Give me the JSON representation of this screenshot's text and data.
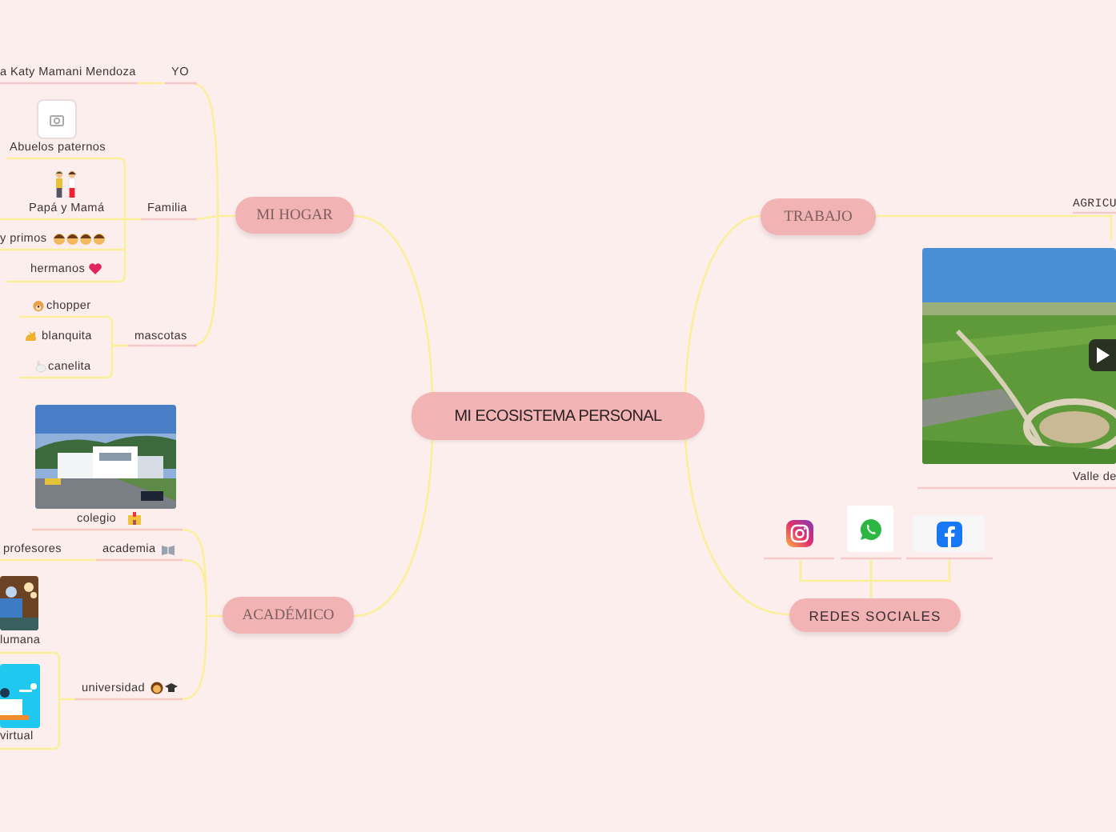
{
  "central": {
    "label": "MI ECOSISTEMA PERSONAL"
  },
  "hogar": {
    "label": "MI HOGAR",
    "yo": {
      "label": "YO",
      "name": "a Katy Mamani Mendoza"
    },
    "familia": {
      "label": "Familia",
      "members": [
        "Abuelos paternos",
        "Papá y Mamá",
        "y primos",
        "hermanos"
      ]
    },
    "mascotas": {
      "label": "mascotas",
      "pets": [
        "chopper",
        "blanquita",
        "canelita"
      ]
    }
  },
  "academico": {
    "label": "ACADÉMICO",
    "colegio": "colegio",
    "academia": {
      "label": "academia",
      "child": "profesores"
    },
    "universidad": {
      "label": "universidad",
      "children": [
        "lumana",
        "virtual"
      ]
    }
  },
  "trabajo": {
    "label": "TRABAJO",
    "area": "AGRICU",
    "video_caption": "Valle de"
  },
  "redes": {
    "label": "REDES SOCIALES"
  }
}
